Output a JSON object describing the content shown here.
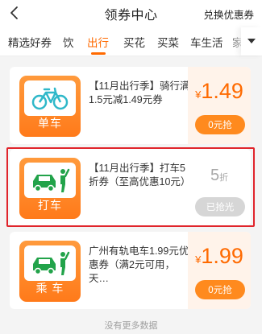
{
  "header": {
    "title": "领券中心",
    "exchange_label": "兑换优惠券"
  },
  "tabs": [
    {
      "label": "精选好券"
    },
    {
      "label": "饮"
    },
    {
      "label": "出行",
      "active": true
    },
    {
      "label": "买花"
    },
    {
      "label": "买菜"
    },
    {
      "label": "车生活"
    },
    {
      "label": "家"
    }
  ],
  "coupons": [
    {
      "icon": "bicycle-icon",
      "caption": "单车",
      "title": "【11月出行季】骑行满1.5元减1.49元券",
      "currency": "¥",
      "price": "1.49",
      "button": "0元抢",
      "state": "available"
    },
    {
      "icon": "taxi-car-icon",
      "caption": "打车",
      "title": "【11月出行季】打车5折券（至高优惠10元）",
      "discount": "5",
      "discount_unit": "折",
      "button": "已抢光",
      "state": "sold-out"
    },
    {
      "icon": "rail-car-icon",
      "caption": "乘 车",
      "title": "广州有轨电车1.99元优惠券（满2元可用，天…",
      "currency": "¥",
      "price": "1.99",
      "button": "0元抢",
      "state": "available"
    }
  ],
  "footer": {
    "text": "没有更多数据"
  },
  "colors": {
    "accent": "#ff6a00",
    "highlight": "#e0242b"
  }
}
